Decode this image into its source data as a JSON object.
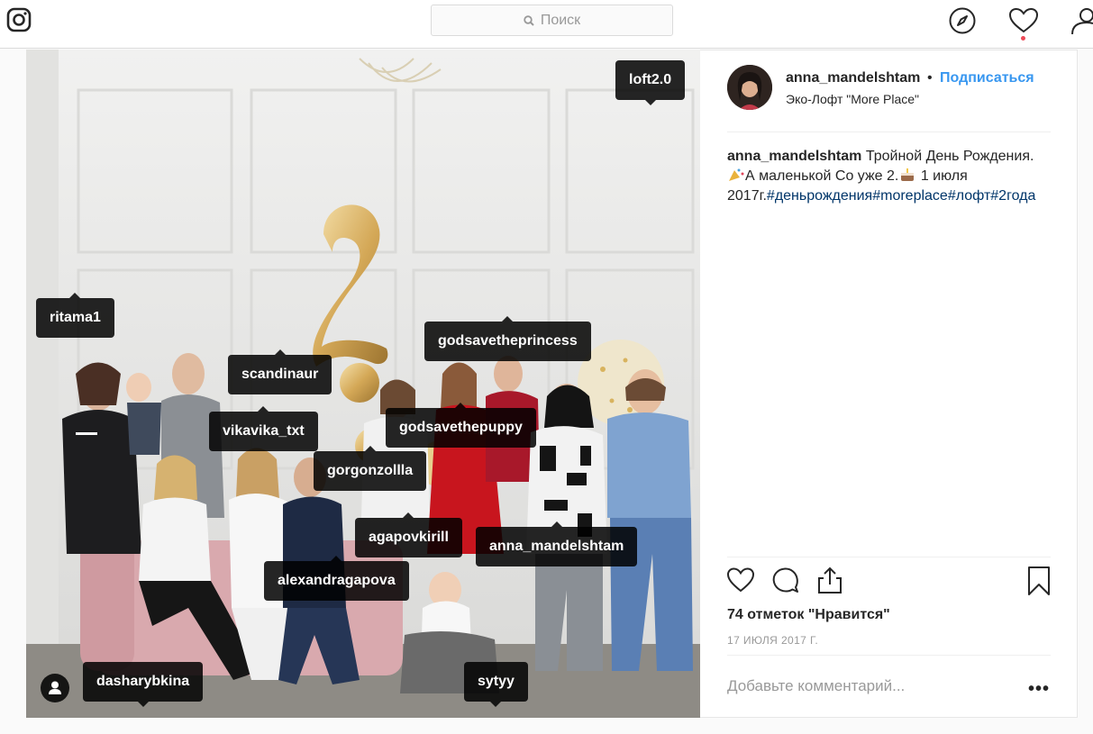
{
  "header": {
    "search_placeholder": "Поиск"
  },
  "post": {
    "username": "anna_mandelshtam",
    "separator": "•",
    "follow_label": "Подписаться",
    "location": "Эко-Лофт \"More Place\"",
    "caption": {
      "username": "anna_mandelshtam",
      "text_1": "Тройной День Рождения.",
      "text_2": "А маленькой Со уже 2.",
      "text_3": "1 июля 2017г.",
      "hashtags": [
        "#деньрождения",
        "#moreplace",
        "#лофт",
        "#2года"
      ]
    },
    "likes": "74 отметок \"Нравится\"",
    "date": "17 ИЮЛЯ 2017 Г.",
    "comment_placeholder": "Добавьте комментарий...",
    "more_label": "•••"
  },
  "tags": [
    {
      "name": "loft2.0"
    },
    {
      "name": "ritama1"
    },
    {
      "name": "godsavetheprincess"
    },
    {
      "name": "scandinaur"
    },
    {
      "name": "vikavika_txt"
    },
    {
      "name": "godsavethepuppy"
    },
    {
      "name": "gorgonzollla"
    },
    {
      "name": "agapovkirill"
    },
    {
      "name": "anna_mandelshtam"
    },
    {
      "name": "alexandragapova"
    },
    {
      "name": "dasharybkina"
    },
    {
      "name": "sytyy"
    }
  ],
  "colors": {
    "link": "#3897f0",
    "hashtag": "#003569",
    "notification_dot": "#ed4956",
    "balloon_gold": "#d9b46a"
  },
  "icons": [
    "instagram-logo-icon",
    "search-icon",
    "explore-compass-icon",
    "heart-icon",
    "profile-icon",
    "like-icon",
    "comment-icon",
    "share-icon",
    "bookmark-icon",
    "user-tag-icon"
  ]
}
